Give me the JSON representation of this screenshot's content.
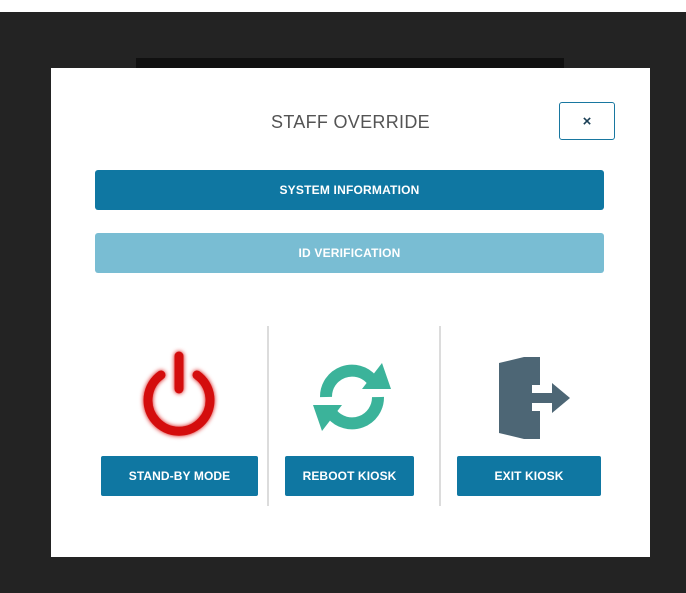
{
  "modal": {
    "title": "STAFF OVERRIDE",
    "close_label": "×",
    "system_information_label": "SYSTEM INFORMATION",
    "id_verification_label": "ID VERIFICATION"
  },
  "actions": [
    {
      "label": "STAND-BY MODE",
      "icon": "power-icon",
      "color": "#d40a0a"
    },
    {
      "label": "REBOOT KIOSK",
      "icon": "reboot-icon",
      "color": "#3bb39a"
    },
    {
      "label": "EXIT KIOSK",
      "icon": "exit-door-icon",
      "color": "#4d6675"
    }
  ],
  "colors": {
    "primary": "#0f77a2",
    "primary_disabled": "#79bdd3",
    "backdrop": "#232323"
  }
}
